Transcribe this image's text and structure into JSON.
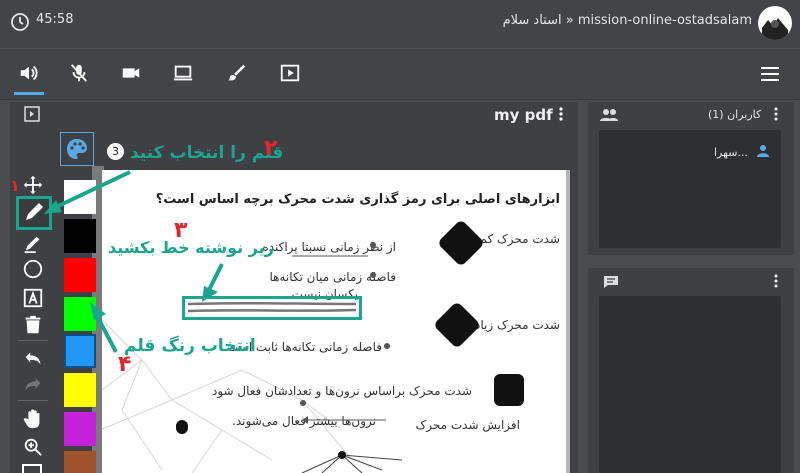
{
  "header": {
    "time": "45:58",
    "session": "استاد سلام » mission-online-ostadsalam"
  },
  "toolbar": {
    "icons": [
      "speaker-icon",
      "mic-off-icon",
      "camera-icon",
      "screen-share-icon",
      "brush-icon",
      "play-icon"
    ],
    "menu": "menu-icon"
  },
  "presentation": {
    "title": "my pdf",
    "page_badge": "3"
  },
  "users_panel": {
    "title": "کاربران (1)",
    "users": [
      "سهرا..."
    ]
  },
  "tools": [
    "move-icon",
    "pen-icon",
    "highlighter-icon",
    "circle-icon",
    "text-icon",
    "trash-icon",
    "undo-icon",
    "redo-icon",
    "hand-icon",
    "zoom-icon"
  ],
  "swatches": [
    "#ffffff",
    "#000000",
    "#ff0000",
    "#00ff00",
    "#2196f3",
    "#ffff00",
    "#c322d9",
    "#a0522d"
  ],
  "annotations": {
    "a1": "۱",
    "a2": "قلم را انتخاب کنید",
    "a2num": "۲",
    "a3": "زیر نوشته خط بکشید",
    "a3num": "۳",
    "a4": "انتخاب رنگ قلم",
    "a4num": "۴"
  },
  "pdf_content": {
    "heading": "ابزارهای اصلی برای رمز گذاری شدت محرک برچه اساس است؟",
    "d1": "شدت محرک کم باشد",
    "l1": "از نظر زمانی نسبتا پراکنده",
    "l2a": "فاصله زمانی میان تکانه‌ها",
    "l2b": "یکسان نیست",
    "d2": "شدت محرک زیاد باشد",
    "l3": "فاصله زمانی تکانه‌ها ثابت است.",
    "l4": "شدت محرک براساس نرون‌ها و تعدادشان فعال شود",
    "l5a": "افزایش شدت محرک",
    "l5b": "نرون‌ها بیشتر فعال می‌شوند."
  }
}
